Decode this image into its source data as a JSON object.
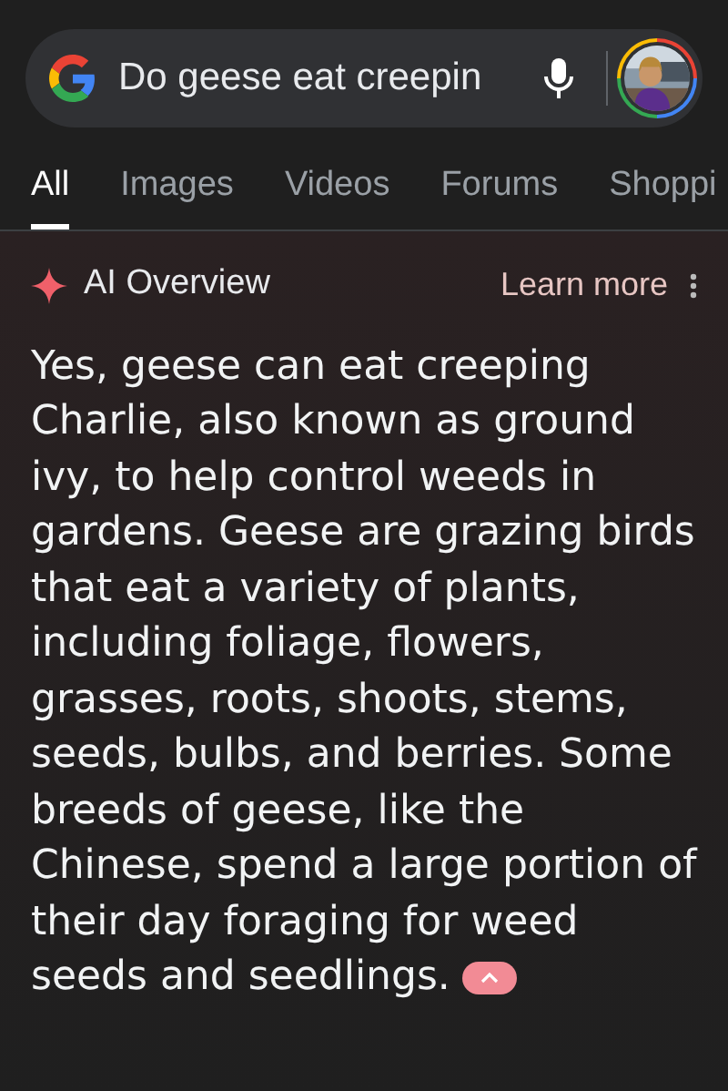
{
  "search": {
    "value": "Do geese eat creepin"
  },
  "tabs": [
    {
      "label": "All",
      "selected": true
    },
    {
      "label": "Images",
      "selected": false
    },
    {
      "label": "Videos",
      "selected": false
    },
    {
      "label": "Forums",
      "selected": false
    },
    {
      "label": "Shoppi",
      "selected": false
    }
  ],
  "ai_overview": {
    "title": "AI Overview",
    "learn_more": "Learn more",
    "text": "Yes, geese can eat creeping Charlie, also known as ground ivy, to help control weeds in gardens. Geese are grazing birds that eat a variety of plants, including foliage, flowers, grasses, roots, shoots, stems, seeds, bulbs, and berries. Some breeds of geese, like the Chinese, spend a large portion of their day foraging for weed seeds and seedlings.",
    "expanded": true
  }
}
